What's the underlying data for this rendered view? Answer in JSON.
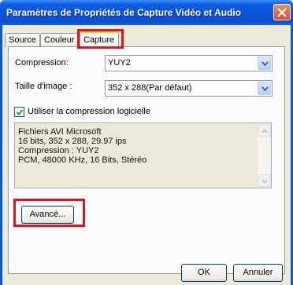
{
  "window": {
    "title": "Paramètres de Propriétés de Capture Vidéo et Audio"
  },
  "tabs": [
    {
      "label": "Source",
      "active": false
    },
    {
      "label": "Couleur",
      "active": false
    },
    {
      "label": "Capture",
      "active": true
    }
  ],
  "compression": {
    "label": "Compression:",
    "value": "YUY2"
  },
  "image_size": {
    "label": "Taille d'image :",
    "value": "352 x 288(Par défaut)"
  },
  "software_compression": {
    "label": "Utiliser la compression logicielle",
    "checked": true
  },
  "info_lines": [
    "Fichiers AVI Microsoft",
    "16 bits, 352 x 288, 29.97 ips",
    "Compression : YUY2",
    "PCM, 48000 KHz, 16 Bits, Stéréo"
  ],
  "buttons": {
    "advanced": "Avancé...",
    "ok": "OK",
    "cancel": "Annuler"
  },
  "colors": {
    "titlebar": "#0a57d6",
    "highlight": "#e8121b",
    "dialog_bg": "#ece9d8"
  }
}
